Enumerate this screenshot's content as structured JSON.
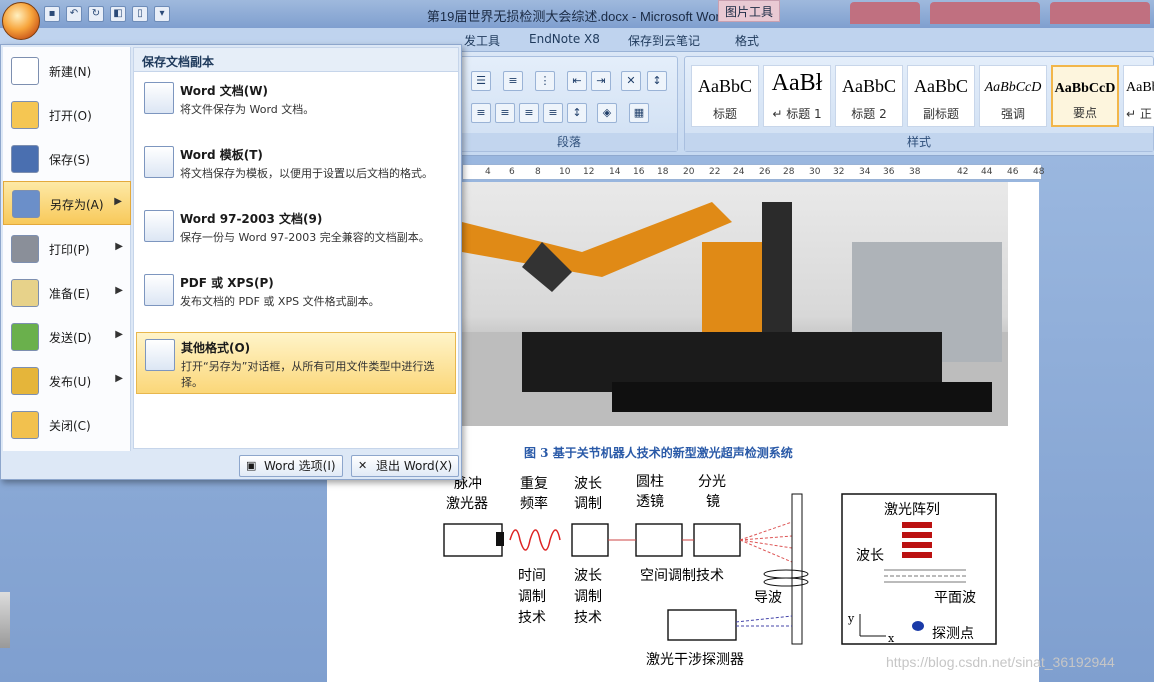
{
  "window": {
    "title": "第19届世界无损检测大会综述.docx - Microsoft Word",
    "context_tab": "图片工具"
  },
  "tabs": [
    {
      "label": "发工具"
    },
    {
      "label": "EndNote X8"
    },
    {
      "label": "保存到云笔记"
    },
    {
      "label": "格式"
    }
  ],
  "ribbon": {
    "paragraph_label": "段落",
    "styles_label": "样式",
    "styles": [
      {
        "sample": "AaBbC",
        "name": "标题"
      },
      {
        "sample": "AaBł",
        "name": "↵ 标题 1"
      },
      {
        "sample": "AaBbC",
        "name": "标题 2"
      },
      {
        "sample": "AaBbC",
        "name": "副标题"
      },
      {
        "sample": "AaBbCcD",
        "name": "强调"
      },
      {
        "sample": "AaBbCcD",
        "name": "要点"
      },
      {
        "sample": "AaBb",
        "name": "↵ 正"
      }
    ]
  },
  "ruler": [
    "4",
    "6",
    "8",
    "10",
    "12",
    "14",
    "16",
    "18",
    "20",
    "22",
    "24",
    "26",
    "28",
    "30",
    "32",
    "34",
    "36",
    "38",
    "42",
    "44",
    "46",
    "48"
  ],
  "menu": {
    "left_items": [
      {
        "label": "新建(N)",
        "icon": "new-document-icon",
        "color": "#ffffff"
      },
      {
        "label": "打开(O)",
        "icon": "open-folder-icon",
        "color": "#f5c652"
      },
      {
        "label": "保存(S)",
        "icon": "save-disk-icon",
        "color": "#4a6fb0"
      },
      {
        "label": "另存为(A)",
        "icon": "save-as-icon",
        "color": "#6b8fc9",
        "arrow": "▶"
      },
      {
        "label": "打印(P)",
        "icon": "print-icon",
        "color": "#8a8f99",
        "arrow": "▶"
      },
      {
        "label": "准备(E)",
        "icon": "prepare-icon",
        "color": "#e7d28a",
        "arrow": "▶"
      },
      {
        "label": "发送(D)",
        "icon": "send-icon",
        "color": "#6ab04c",
        "arrow": "▶"
      },
      {
        "label": "发布(U)",
        "icon": "publish-icon",
        "color": "#e5b53a",
        "arrow": "▶"
      },
      {
        "label": "关闭(C)",
        "icon": "close-folder-icon",
        "color": "#f2c14e"
      }
    ],
    "right_header": "保存文档副本",
    "right_items": [
      {
        "title": "Word 文档(W)",
        "desc": "将文件保存为 Word 文档。",
        "icon": "word-document-icon"
      },
      {
        "title": "Word 模板(T)",
        "desc": "将文档保存为模板，以便用于设置以后文档的格式。",
        "icon": "word-template-icon"
      },
      {
        "title": "Word 97-2003 文档(9)",
        "desc": "保存一份与 Word 97-2003 完全兼容的文档副本。",
        "icon": "word-97-icon"
      },
      {
        "title": "PDF 或 XPS(P)",
        "desc": "发布文档的 PDF 或 XPS 文件格式副本。",
        "icon": "pdf-xps-icon"
      },
      {
        "title": "其他格式(O)",
        "desc": "打开“另存为”对话框，从所有可用文件类型中进行选择。",
        "icon": "other-formats-icon"
      }
    ],
    "options_label": "Word 选项(I)",
    "exit_label": "退出 Word(X)"
  },
  "document": {
    "caption": "图 3   基于关节机器人技术的新型激光超声检测系统",
    "diagram": {
      "laser": "脉冲\n激光器",
      "rep_rate": "重复\n频率",
      "wavelength_mod": "波长\n调制",
      "cyl_lens": "圆柱\n透镜",
      "splitter": "分光\n镜",
      "time_mod": "时间\n调制\n技术",
      "wavelength_tech": "波长\n调制\n技术",
      "spatial": "空间调制技术",
      "guided": "导波",
      "detector": "激光干涉探测器",
      "array": "激光阵列",
      "wavelen": "波长",
      "plane": "平面波",
      "probe": "探测点",
      "axis_y": "y",
      "axis_x": "x"
    }
  },
  "watermark": "https://blog.csdn.net/sinat_36192944"
}
